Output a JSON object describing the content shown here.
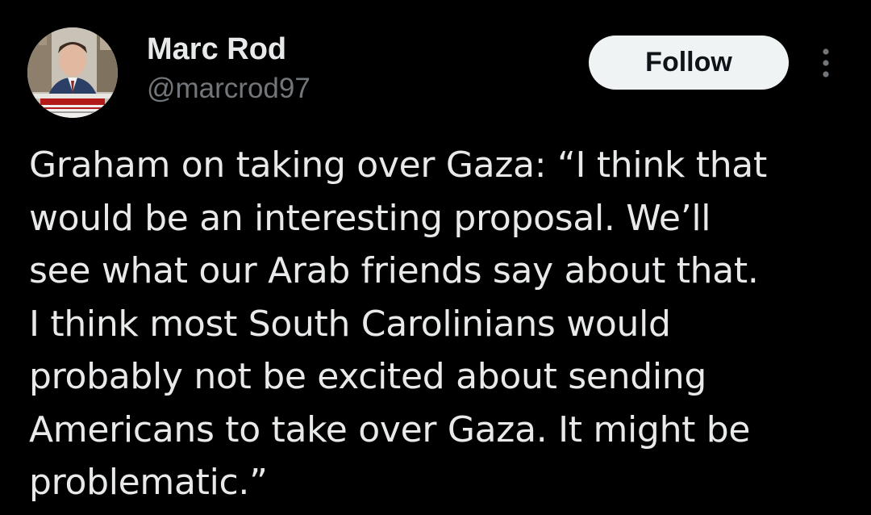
{
  "tweet": {
    "author": {
      "display_name": "Marc Rod",
      "handle": "@marcrod97",
      "avatar_icon": "profile-photo"
    },
    "follow_label": "Follow",
    "more_icon": "more-vertical-icon",
    "text": "Graham on taking over Gaza: “I think that\nwould be an interesting proposal. We’ll\nsee what our Arab friends say about that.\nI think most South Carolinians would\nprobably not be excited about sending\nAmericans to take over Gaza. It might be\nproblematic.”"
  },
  "colors": {
    "background": "#000000",
    "text_primary": "#e7e9ea",
    "text_secondary": "#71767b",
    "follow_bg": "#eff3f4",
    "follow_text": "#0f1419"
  }
}
